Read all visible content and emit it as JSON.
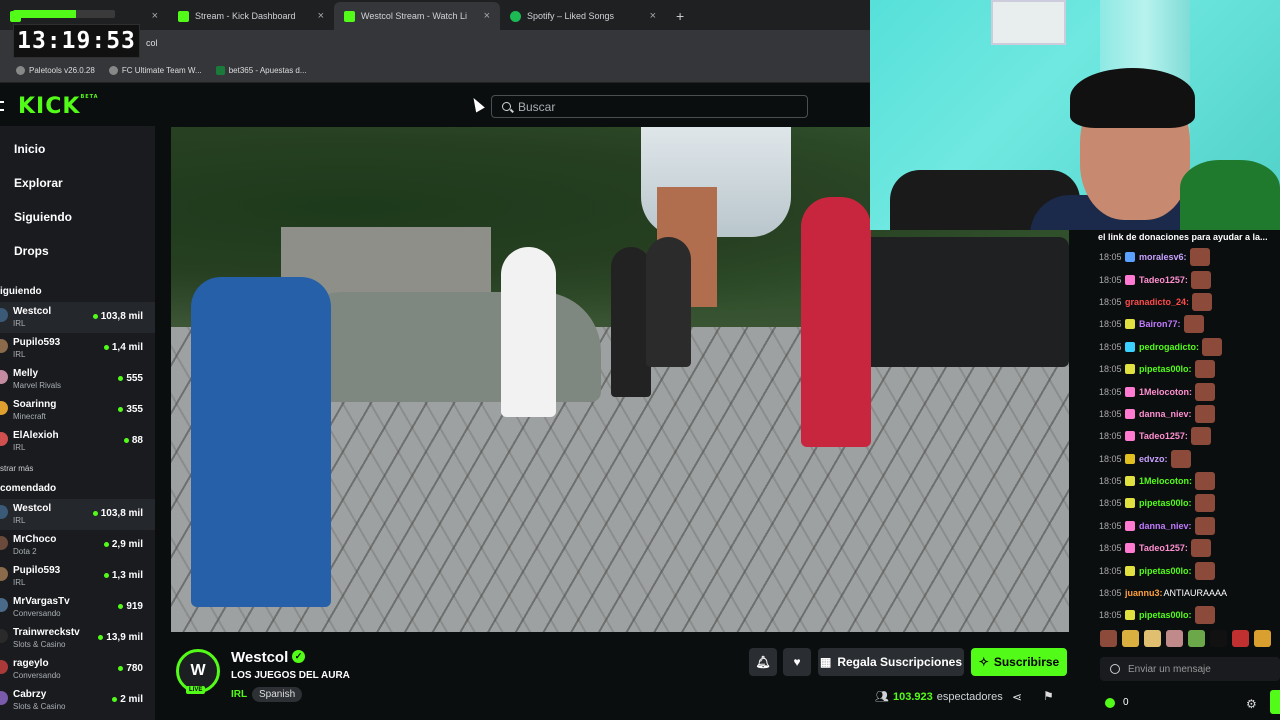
{
  "browser": {
    "tabs": [
      {
        "label": "",
        "color": "#53fc18"
      },
      {
        "label": "Stream - Kick Dashboard",
        "color": "#53fc18"
      },
      {
        "label": "Westcol Stream - Watch Li",
        "color": "#53fc18"
      },
      {
        "label": "Spotify – Liked Songs",
        "color": "#1db954"
      }
    ],
    "url_partial": "col",
    "bookmarks": [
      "Paletools v26.0.28",
      "FC Ultimate Team W...",
      "bet365 - Apuestas d..."
    ]
  },
  "clock": "13:19:53",
  "header": {
    "logo": "KICK",
    "logo_badge": "BETA",
    "search_placeholder": "Buscar"
  },
  "sidebar": {
    "nav": [
      "Inicio",
      "Explorar",
      "Siguiendo",
      "Drops"
    ],
    "following_title": "iguiendo",
    "following": [
      {
        "name": "Westcol",
        "category": "IRL",
        "viewers": "103,8 mil",
        "avatar": "#3a5a78"
      },
      {
        "name": "Pupilo593",
        "category": "IRL",
        "viewers": "1,4 mil",
        "avatar": "#8a6a4a"
      },
      {
        "name": "Melly",
        "category": "Marvel Rivals",
        "viewers": "555",
        "avatar": "#c48aa0"
      },
      {
        "name": "Soarinng",
        "category": "Minecraft",
        "viewers": "355",
        "avatar": "#e0a030"
      },
      {
        "name": "ElAlexioh",
        "category": "IRL",
        "viewers": "88",
        "avatar": "#d05050"
      }
    ],
    "show_more": "strar más",
    "recommended_title": "comendado",
    "recommended": [
      {
        "name": "Westcol",
        "category": "IRL",
        "viewers": "103,8 mil",
        "avatar": "#3a5a78"
      },
      {
        "name": "MrChoco",
        "category": "Dota 2",
        "viewers": "2,9 mil",
        "avatar": "#6a4a3a"
      },
      {
        "name": "Pupilo593",
        "category": "IRL",
        "viewers": "1,3 mil",
        "avatar": "#8a6a4a"
      },
      {
        "name": "MrVargasTv",
        "category": "Conversando",
        "viewers": "919",
        "avatar": "#4a6a8a"
      },
      {
        "name": "Trainwreckstv",
        "category": "Slots & Casino",
        "viewers": "13,9 mil",
        "avatar": "#2a2a2a"
      },
      {
        "name": "rageylo",
        "category": "Conversando",
        "viewers": "780",
        "avatar": "#aa3a3a"
      },
      {
        "name": "Cabrzy",
        "category": "Slots & Casino",
        "viewers": "2 mil",
        "avatar": "#7a5aaa"
      }
    ]
  },
  "stream": {
    "channel": "Westcol",
    "avatar_text": "W",
    "live_badge": "LIVE",
    "title": "LOS JUEGOS DEL AURA",
    "category": "IRL",
    "language": "Spanish",
    "gift_label": "Regala Suscripciones",
    "subscribe_label": "Suscribirse",
    "viewers": "103.923",
    "viewers_label": "espectadores"
  },
  "chat": {
    "pinned": "el link de donaciones para ayudar a la...",
    "messages": [
      {
        "time": "18:05",
        "user": "moralesv6:",
        "color": "#c7a0ff",
        "badge": "#5aa0ff",
        "text": "",
        "emote": true
      },
      {
        "time": "18:05",
        "user": "Tadeo1257:",
        "color": "#ff8fd0",
        "badge": "#ff7ad0",
        "text": "",
        "emote": true
      },
      {
        "time": "18:05",
        "user": "granadicto_24:",
        "color": "#ff4a4a",
        "badge": "",
        "text": "",
        "emote": true
      },
      {
        "time": "18:05",
        "user": "Bairon77:",
        "color": "#c07aff",
        "badge": "#e0e040",
        "text": "",
        "emote": true
      },
      {
        "time": "18:05",
        "user": "pedrogadicto:",
        "color": "#53fc18",
        "badge": "#3ad0ff",
        "text": "",
        "emote": true
      },
      {
        "time": "18:05",
        "user": "pipetas00lo:",
        "color": "#53fc18",
        "badge": "#e0e040",
        "text": "",
        "emote": true
      },
      {
        "time": "18:05",
        "user": "1Melocoton:",
        "color": "#ff8fd0",
        "badge": "#ff7ad0",
        "text": "",
        "emote": true
      },
      {
        "time": "18:05",
        "user": "danna_niev:",
        "color": "#ff8fd0",
        "badge": "#ff7ad0",
        "text": "",
        "emote": true
      },
      {
        "time": "18:05",
        "user": "Tadeo1257:",
        "color": "#ff8fd0",
        "badge": "#ff7ad0",
        "text": "",
        "emote": true
      },
      {
        "time": "18:05",
        "user": "edvzo:",
        "color": "#c7a0ff",
        "badge": "#e0c020",
        "text": "",
        "emote": true
      },
      {
        "time": "18:05",
        "user": "1Melocoton:",
        "color": "#53fc18",
        "badge": "#e0e040",
        "text": "",
        "emote": true
      },
      {
        "time": "18:05",
        "user": "pipetas00lo:",
        "color": "#53fc18",
        "badge": "#e0e040",
        "text": "",
        "emote": true
      },
      {
        "time": "18:05",
        "user": "danna_niev:",
        "color": "#c07aff",
        "badge": "#ff7ad0",
        "text": "",
        "emote": true
      },
      {
        "time": "18:05",
        "user": "Tadeo1257:",
        "color": "#ff8fd0",
        "badge": "#ff7ad0",
        "text": "",
        "emote": true
      },
      {
        "time": "18:05",
        "user": "pipetas00lo:",
        "color": "#53fc18",
        "badge": "#e0e040",
        "text": "",
        "emote": true
      },
      {
        "time": "18:05",
        "user": "juannu3:",
        "color": "#ff9f40",
        "badge": "",
        "text": "ANTIAURAAAA",
        "emote": false
      },
      {
        "time": "18:05",
        "user": "pipetas00lo:",
        "color": "#53fc18",
        "badge": "#e0e040",
        "text": "",
        "emote": true
      }
    ],
    "input_placeholder": "Enviar un mensaje",
    "kicks": "0"
  },
  "colors": {
    "accent": "#53fc18",
    "bg": "#0b0e0f",
    "sidebar": "#191b1f"
  }
}
